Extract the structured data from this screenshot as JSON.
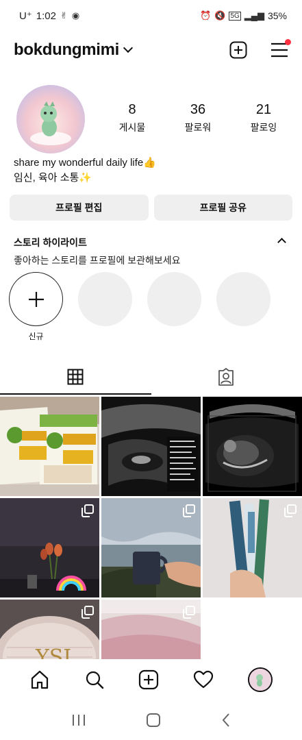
{
  "status_bar": {
    "carrier": "U⁺",
    "time": "1:02",
    "network": "5G",
    "battery": "35%"
  },
  "header": {
    "username": "bokdungmimi"
  },
  "profile": {
    "stats": [
      {
        "value": "8",
        "label": "게시물"
      },
      {
        "value": "36",
        "label": "팔로워"
      },
      {
        "value": "21",
        "label": "팔로잉"
      }
    ],
    "bio_line1": "share my wonderful daily life👍",
    "bio_line2": "임신, 육아 소통✨",
    "edit_button": "프로필 편집",
    "share_button": "프로필 공유"
  },
  "highlights": {
    "title": "스토리 하이라이트",
    "subtitle": "좋아하는 스토리를 프로필에 보관해보세요",
    "new_label": "신규"
  },
  "posts": [
    {
      "kind": "product-boxes",
      "multi": false
    },
    {
      "kind": "ultrasound-1",
      "multi": false
    },
    {
      "kind": "ultrasound-2",
      "multi": false
    },
    {
      "kind": "tulip-rainbow",
      "multi": true
    },
    {
      "kind": "sea-mug",
      "multi": true
    },
    {
      "kind": "book-tubes",
      "multi": true
    },
    {
      "kind": "cushion-compact",
      "multi": true
    },
    {
      "kind": "pink-drink",
      "multi": true
    }
  ],
  "colors": {
    "notification": "#ff3040",
    "button_bg": "#efefef"
  }
}
